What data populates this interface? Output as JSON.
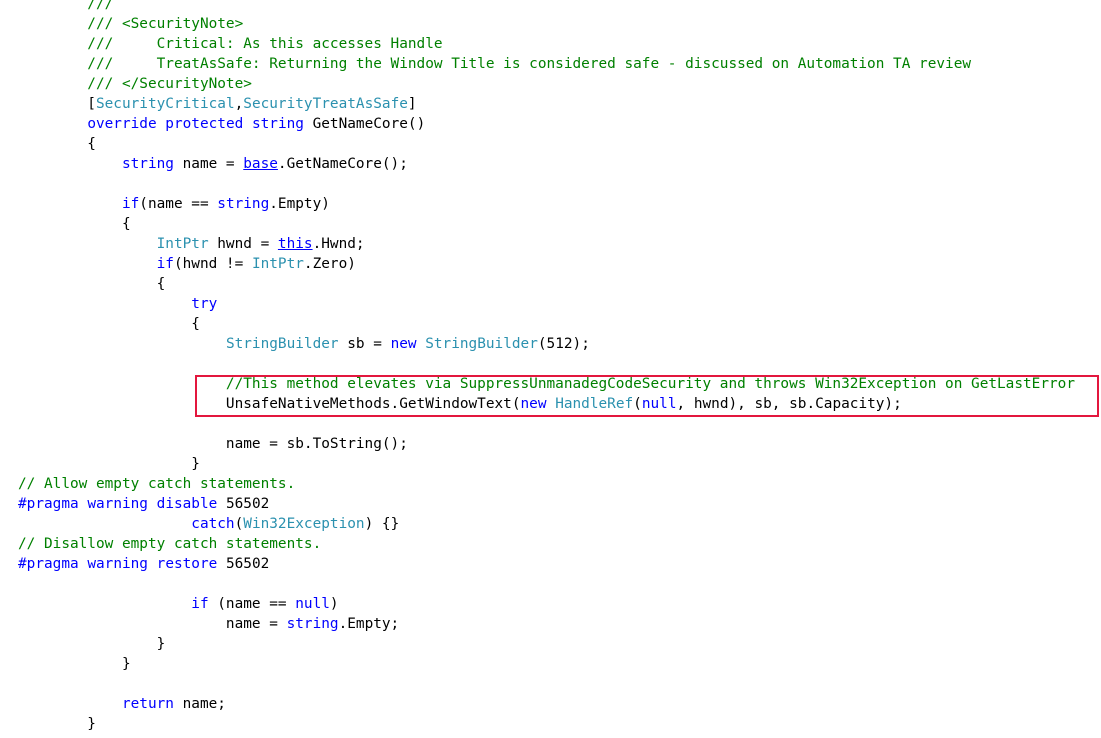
{
  "editor": {
    "highlight_color": "#e3173e",
    "colors": {
      "comment": "#008000",
      "keyword": "#0000ff",
      "type": "#2b91af",
      "plain": "#000000",
      "doc_tag": "#808080"
    },
    "lines": [
      [
        {
          "t": "        ///",
          "c": "comment"
        }
      ],
      [
        {
          "t": "        /// ",
          "c": "comment"
        },
        {
          "t": "<SecurityNote>",
          "c": "comment"
        }
      ],
      [
        {
          "t": "        ///     Critical: As this accesses Handle",
          "c": "comment"
        }
      ],
      [
        {
          "t": "        ///     TreatAsSafe: Returning the Window Title is considered safe - discussed on Automation TA review",
          "c": "comment"
        }
      ],
      [
        {
          "t": "        /// ",
          "c": "comment"
        },
        {
          "t": "</SecurityNote>",
          "c": "comment"
        }
      ],
      [
        {
          "t": "        [",
          "c": "plain"
        },
        {
          "t": "SecurityCritical",
          "c": "type"
        },
        {
          "t": ",",
          "c": "plain"
        },
        {
          "t": "SecurityTreatAsSafe",
          "c": "type"
        },
        {
          "t": "]",
          "c": "plain"
        }
      ],
      [
        {
          "t": "        ",
          "c": "plain"
        },
        {
          "t": "override",
          "c": "keyword"
        },
        {
          "t": " ",
          "c": "plain"
        },
        {
          "t": "protected",
          "c": "keyword"
        },
        {
          "t": " ",
          "c": "plain"
        },
        {
          "t": "string",
          "c": "keyword"
        },
        {
          "t": " GetNameCore()",
          "c": "plain"
        }
      ],
      [
        {
          "t": "        {",
          "c": "plain"
        }
      ],
      [
        {
          "t": "            ",
          "c": "plain"
        },
        {
          "t": "string",
          "c": "keyword"
        },
        {
          "t": " name = ",
          "c": "plain"
        },
        {
          "t": "base",
          "c": "keyword",
          "u": true
        },
        {
          "t": ".GetNameCore();",
          "c": "plain"
        }
      ],
      [
        {
          "t": "",
          "c": "plain"
        }
      ],
      [
        {
          "t": "            ",
          "c": "plain"
        },
        {
          "t": "if",
          "c": "keyword"
        },
        {
          "t": "(name == ",
          "c": "plain"
        },
        {
          "t": "string",
          "c": "keyword"
        },
        {
          "t": ".Empty)",
          "c": "plain"
        }
      ],
      [
        {
          "t": "            {",
          "c": "plain"
        }
      ],
      [
        {
          "t": "                ",
          "c": "plain"
        },
        {
          "t": "IntPtr",
          "c": "type"
        },
        {
          "t": " hwnd = ",
          "c": "plain"
        },
        {
          "t": "this",
          "c": "keyword",
          "u": true
        },
        {
          "t": ".Hwnd;",
          "c": "plain"
        }
      ],
      [
        {
          "t": "                ",
          "c": "plain"
        },
        {
          "t": "if",
          "c": "keyword"
        },
        {
          "t": "(hwnd != ",
          "c": "plain"
        },
        {
          "t": "IntPtr",
          "c": "type"
        },
        {
          "t": ".Zero)",
          "c": "plain"
        }
      ],
      [
        {
          "t": "                {",
          "c": "plain"
        }
      ],
      [
        {
          "t": "                    ",
          "c": "plain"
        },
        {
          "t": "try",
          "c": "keyword"
        }
      ],
      [
        {
          "t": "                    {",
          "c": "plain"
        }
      ],
      [
        {
          "t": "                        ",
          "c": "plain"
        },
        {
          "t": "StringBuilder",
          "c": "type"
        },
        {
          "t": " sb = ",
          "c": "plain"
        },
        {
          "t": "new",
          "c": "keyword"
        },
        {
          "t": " ",
          "c": "plain"
        },
        {
          "t": "StringBuilder",
          "c": "type"
        },
        {
          "t": "(512);",
          "c": "plain"
        }
      ],
      [
        {
          "t": "",
          "c": "plain"
        }
      ],
      [
        {
          "t": "                        //This method elevates via SuppressUnmanadegCodeSecurity and throws Win32Exception on GetLastError",
          "c": "comment"
        }
      ],
      [
        {
          "t": "                        UnsafeNativeMethods.GetWindowText(",
          "c": "plain"
        },
        {
          "t": "new",
          "c": "keyword"
        },
        {
          "t": " ",
          "c": "plain"
        },
        {
          "t": "HandleRef",
          "c": "type"
        },
        {
          "t": "(",
          "c": "plain"
        },
        {
          "t": "null",
          "c": "keyword"
        },
        {
          "t": ", hwnd), sb, sb.Capacity);",
          "c": "plain"
        }
      ],
      [
        {
          "t": "",
          "c": "plain"
        }
      ],
      [
        {
          "t": "                        name = sb.ToString();",
          "c": "plain"
        }
      ],
      [
        {
          "t": "                    }",
          "c": "plain"
        }
      ],
      [
        {
          "t": "// Allow empty catch statements.",
          "c": "comment"
        }
      ],
      [
        {
          "t": "#pragma",
          "c": "keyword"
        },
        {
          "t": " ",
          "c": "plain"
        },
        {
          "t": "warning",
          "c": "keyword"
        },
        {
          "t": " ",
          "c": "plain"
        },
        {
          "t": "disable",
          "c": "keyword"
        },
        {
          "t": " 56502",
          "c": "plain"
        }
      ],
      [
        {
          "t": "                    ",
          "c": "plain"
        },
        {
          "t": "catch",
          "c": "keyword"
        },
        {
          "t": "(",
          "c": "plain"
        },
        {
          "t": "Win32Exception",
          "c": "type"
        },
        {
          "t": ") {}",
          "c": "plain"
        }
      ],
      [
        {
          "t": "// Disallow empty catch statements.",
          "c": "comment"
        }
      ],
      [
        {
          "t": "#pragma",
          "c": "keyword"
        },
        {
          "t": " ",
          "c": "plain"
        },
        {
          "t": "warning",
          "c": "keyword"
        },
        {
          "t": " ",
          "c": "plain"
        },
        {
          "t": "restore",
          "c": "keyword"
        },
        {
          "t": " 56502",
          "c": "plain"
        }
      ],
      [
        {
          "t": "",
          "c": "plain"
        }
      ],
      [
        {
          "t": "                    ",
          "c": "plain"
        },
        {
          "t": "if",
          "c": "keyword"
        },
        {
          "t": " (name == ",
          "c": "plain"
        },
        {
          "t": "null",
          "c": "keyword"
        },
        {
          "t": ")",
          "c": "plain"
        }
      ],
      [
        {
          "t": "                        name = ",
          "c": "plain"
        },
        {
          "t": "string",
          "c": "keyword"
        },
        {
          "t": ".Empty;",
          "c": "plain"
        }
      ],
      [
        {
          "t": "                }",
          "c": "plain"
        }
      ],
      [
        {
          "t": "            }",
          "c": "plain"
        }
      ],
      [
        {
          "t": "",
          "c": "plain"
        }
      ],
      [
        {
          "t": "            ",
          "c": "plain"
        },
        {
          "t": "return",
          "c": "keyword"
        },
        {
          "t": " name;",
          "c": "plain"
        }
      ],
      [
        {
          "t": "        }",
          "c": "plain"
        }
      ]
    ]
  }
}
